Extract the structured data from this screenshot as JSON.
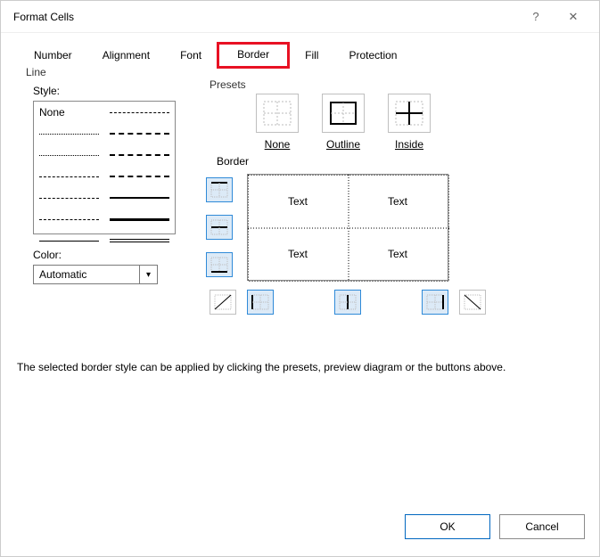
{
  "dialog_title": "Format Cells",
  "titlebar": {
    "help": "?",
    "close": "✕"
  },
  "tabs": {
    "number": "Number",
    "alignment": "Alignment",
    "font": "Font",
    "border": "Border",
    "fill": "Fill",
    "protection": "Protection",
    "active": "border"
  },
  "line_group": {
    "label": "Line",
    "style_label": "Style:",
    "none_label": "None",
    "color_label": "Color:",
    "color_value": "Automatic"
  },
  "presets_group": {
    "label": "Presets",
    "items": {
      "none": "None",
      "outline": "Outline",
      "inside": "Inside"
    }
  },
  "border_group": {
    "label": "Border",
    "sample_text": "Text",
    "side_buttons": {
      "top": {
        "selected": true
      },
      "horizontal_inner": {
        "selected": true
      },
      "bottom": {
        "selected": true
      },
      "diag_up": {
        "selected": false
      },
      "left": {
        "selected": true
      },
      "vertical_inner": {
        "selected": true
      },
      "right": {
        "selected": true
      },
      "diag_down": {
        "selected": false
      }
    }
  },
  "hint_text": "The selected border style can be applied by clicking the presets, preview diagram or the buttons above.",
  "buttons": {
    "ok": "OK",
    "cancel": "Cancel"
  }
}
